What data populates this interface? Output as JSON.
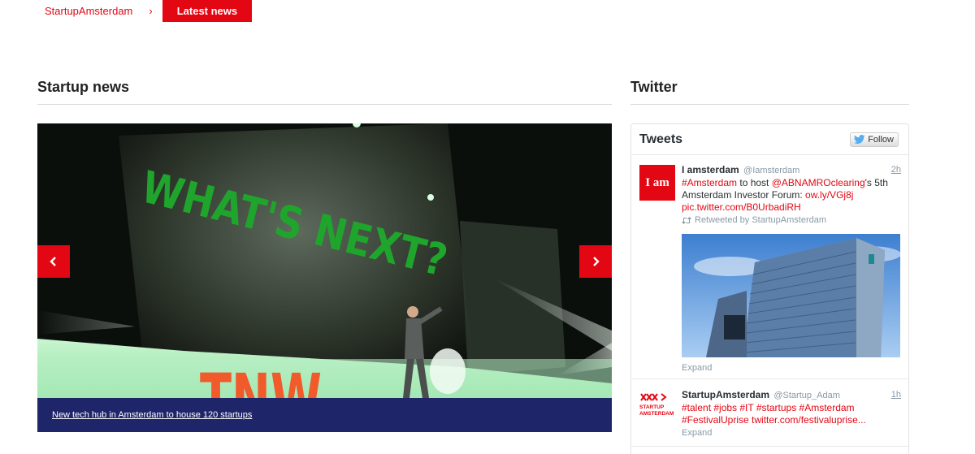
{
  "breadcrumb": {
    "home": "StartupAmsterdam",
    "separator": "›",
    "current": "Latest news"
  },
  "news": {
    "title": "Startup news",
    "slide": {
      "caption": "New tech hub in Amsterdam to house 120 startups",
      "image_text": "WHAT'S NEXT?",
      "logo_text": "TNW"
    },
    "prev_icon": "chevron-left-icon",
    "next_icon": "chevron-right-icon"
  },
  "twitter": {
    "title": "Twitter",
    "widget_title": "Tweets",
    "follow_label": "Follow",
    "tweets": [
      {
        "avatar_text": "I am",
        "name": "I amsterdam",
        "handle": "@Iamsterdam",
        "time": "2h",
        "parts": [
          "#Amsterdam",
          " to host ",
          "@ABNAMROclearing",
          "'s 5th Amsterdam Investor Forum: ",
          "ow.ly/VGj8j",
          " ",
          "pic.twitter.com/B0UrbadiRH"
        ],
        "retweeted_by": "Retweeted by StartupAmsterdam",
        "expand": "Expand"
      },
      {
        "avatar_text": "STARTUP AMSTERDAM",
        "name": "StartupAmsterdam",
        "handle": "@Startup_Adam",
        "time": "1h",
        "text": "#talent #jobs #IT #startups #Amsterdam #FestivalUprise twitter.com/festivaluprise...",
        "expand": "Expand"
      }
    ]
  },
  "colors": {
    "brand_red": "#e30613",
    "caption_bg": "#1e2569",
    "stage_green": "#1fa52c"
  }
}
